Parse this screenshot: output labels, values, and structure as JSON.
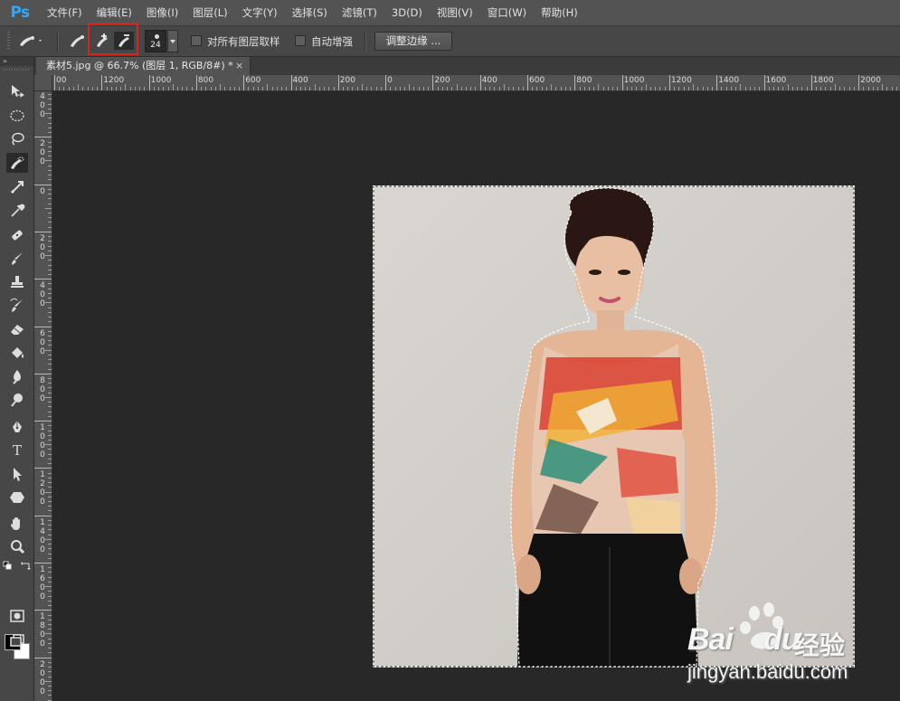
{
  "app": {
    "logo": "Ps"
  },
  "menu": [
    "文件(F)",
    "编辑(E)",
    "图像(I)",
    "图层(L)",
    "文字(Y)",
    "选择(S)",
    "滤镜(T)",
    "3D(D)",
    "视图(V)",
    "窗口(W)",
    "帮助(H)"
  ],
  "options": {
    "brush_size": "24",
    "sample_all_layers_label": "对所有图层取样",
    "sample_all_layers_checked": false,
    "auto_enhance_label": "自动增强",
    "auto_enhance_checked": false,
    "refine_edge_label": "调整边缘 ..."
  },
  "document": {
    "tab_title": "素材5.jpg @ 66.7% (图层 1, RGB/8#) *",
    "tab_close": "×"
  },
  "ruler": {
    "top_labels": [
      "00",
      "1200",
      "1000",
      "800",
      "600",
      "400",
      "200",
      "0",
      "200",
      "400",
      "600",
      "800",
      "1000",
      "1200",
      "1400",
      "1600",
      "1800",
      "2000"
    ],
    "left_labels": [
      "400",
      "200",
      "0",
      "200",
      "400",
      "600",
      "800",
      "1000",
      "1200",
      "1400",
      "1600",
      "1800",
      "2000"
    ]
  },
  "tools": [
    "move-icon",
    "elliptical-marquee-icon",
    "lasso-icon",
    "quick-selection-icon",
    "crop-icon",
    "eyedropper-icon",
    "healing-brush-icon",
    "brush-icon",
    "clone-stamp-icon",
    "history-brush-icon",
    "eraser-icon",
    "paint-bucket-icon",
    "blur-icon",
    "dodge-icon",
    "pen-icon",
    "type-icon",
    "path-selection-icon",
    "shape-icon",
    "hand-icon",
    "zoom-icon"
  ],
  "colors": {
    "foreground": "#000000",
    "background": "#ffffff",
    "highlight": "#d9241c"
  },
  "watermark": {
    "brand": "Bai",
    "brand2": "du",
    "cn": "经验",
    "url": "jingyan.baidu.com"
  }
}
